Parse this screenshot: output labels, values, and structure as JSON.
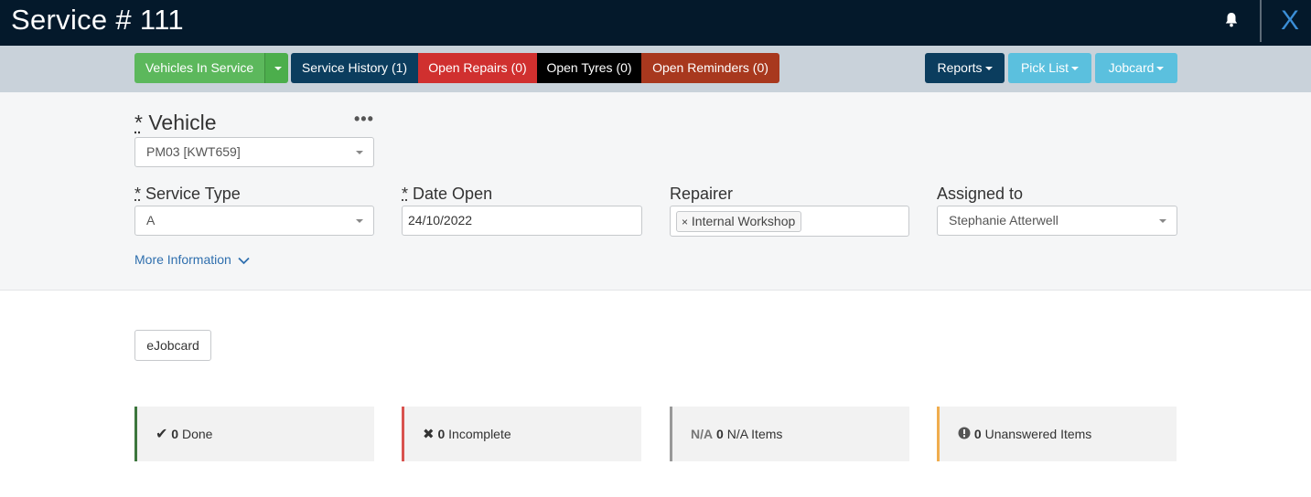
{
  "header": {
    "title": "Service # 111",
    "close_label": "X",
    "bell_icon": "bell-icon"
  },
  "toolbar": {
    "vehicles_in_service": "Vehicles In Service",
    "service_history": "Service History (1)",
    "open_repairs": "Open Repairs (0)",
    "open_tyres": "Open Tyres (0)",
    "open_reminders": "Open Reminders (0)",
    "reports": "Reports",
    "pick_list": "Pick List",
    "jobcard": "Jobcard"
  },
  "form": {
    "vehicle_label": "Vehicle",
    "vehicle_value": "PM03 [KWT659]",
    "required_mark": "*",
    "service_type_label": "Service Type",
    "service_type_value": "A",
    "date_open_label": "Date Open",
    "date_open_value": "24/10/2022",
    "repairer_label": "Repairer",
    "repairer_tag": "Internal Workshop",
    "assigned_label": "Assigned to",
    "assigned_value": "Stephanie Atterwell",
    "more_info": "More Information"
  },
  "ejobcard_label": "eJobcard",
  "stats": {
    "done": {
      "icon": "✔",
      "count": "0",
      "label": "Done"
    },
    "incomplete": {
      "icon": "✖",
      "count": "0",
      "label": "Incomplete"
    },
    "na": {
      "prefix": "N/A",
      "count": "0",
      "label": "N/A Items"
    },
    "unanswered": {
      "count": "0",
      "label": "Unanswered Items"
    }
  },
  "colors": {
    "green": "#4cae4c",
    "navy": "#0b3d5e",
    "red": "#d0302f",
    "black": "#000000",
    "rust": "#a8381e",
    "lightblue": "#5bc0de"
  }
}
